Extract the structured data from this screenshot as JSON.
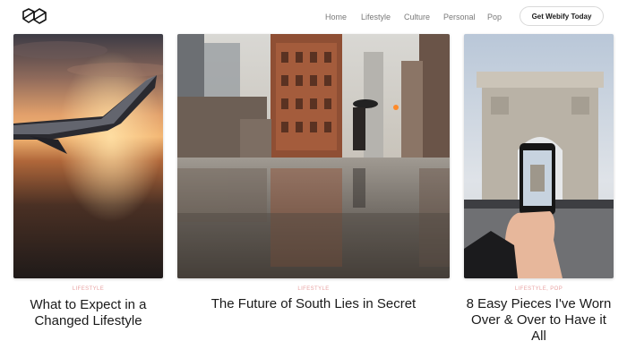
{
  "header": {
    "logo_icon": "hexagon-logo-icon",
    "nav": [
      "Home",
      "Lifestyle",
      "Culture",
      "Personal",
      "Pop"
    ],
    "cta_label": "Get Webify Today"
  },
  "colors": {
    "category_accent": "#e8a3a3",
    "nav_text": "#7a7a7a",
    "title_text": "#1a1a1a"
  },
  "cards": [
    {
      "category": "LIFESTYLE",
      "title": "What to Expect in a Changed Lifestyle",
      "image": "airplane-wing-sunset-photo"
    },
    {
      "category": "LIFESTYLE",
      "title": "The Future of South Lies in Secret",
      "image": "rainy-city-street-umbrella-photo"
    },
    {
      "category": "LIFESTYLE, POP",
      "title": "8 Easy Pieces I've Worn Over & Over to Have it All",
      "image": "arc-de-triomphe-phone-photo"
    }
  ]
}
